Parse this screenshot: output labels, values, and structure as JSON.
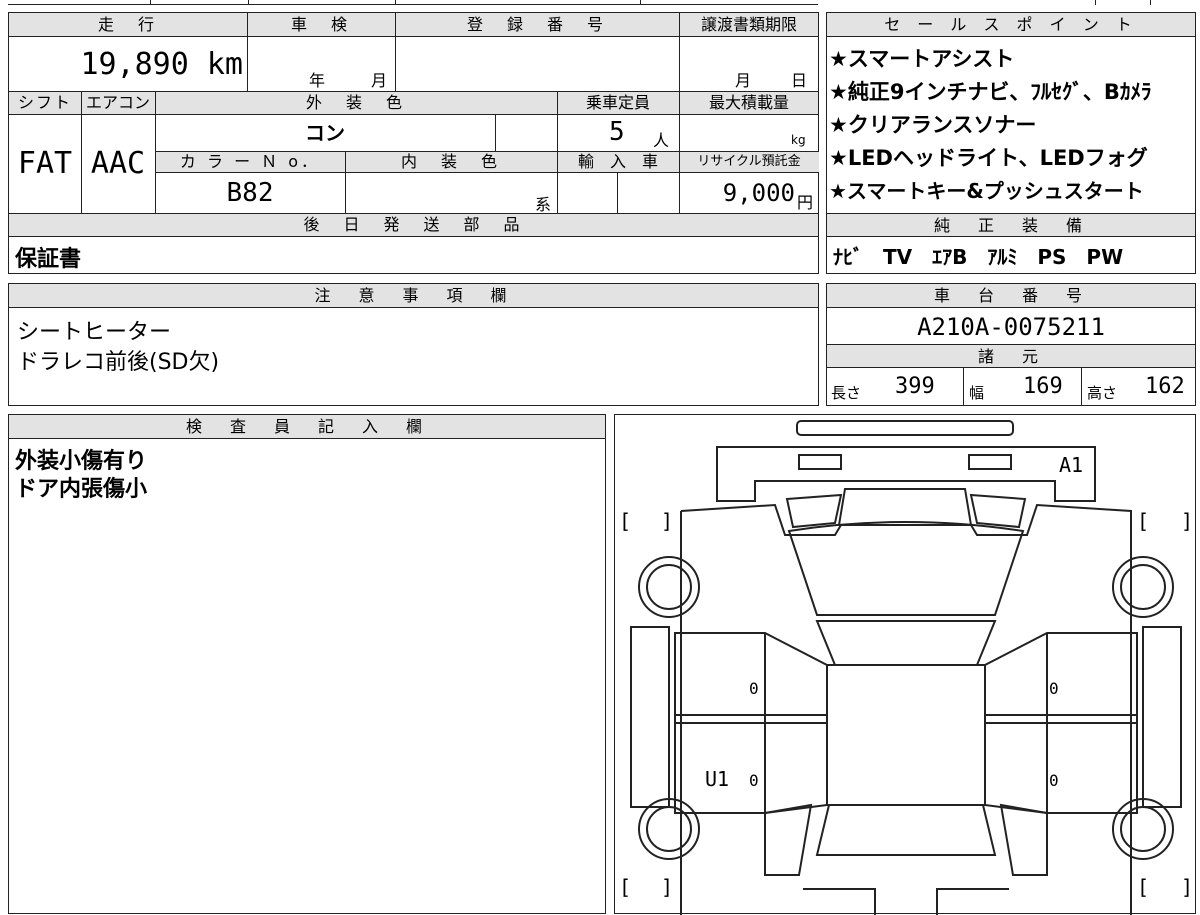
{
  "main": {
    "h_mileage": "走　行",
    "h_inspection": "車　検",
    "h_registration": "登　録　番　号",
    "h_transfer_deadline": "譲渡書類期限",
    "mileage_value": "19,890 km",
    "inspection_year": "年",
    "inspection_month": "月",
    "transfer_month": "月",
    "transfer_day": "日",
    "h_shift": "シフト",
    "h_aircon": "エアコン",
    "h_exterior_color": "外　装　色",
    "h_capacity": "乗車定員",
    "h_max_load": "最大積載量",
    "shift_value": "FAT",
    "aircon_value": "AAC",
    "exterior_color_value": "コン",
    "capacity_value": "5",
    "capacity_unit": "人",
    "max_load_unit": "kg",
    "h_color_no": "カ ラ ー Ｎ o．",
    "h_interior_color": "内　装　色",
    "h_import": "輸　入　車",
    "h_recycle": "リサイクル預託金",
    "color_no_value": "B82",
    "interior_suffix": "系",
    "recycle_value": "9,000",
    "recycle_unit": "円",
    "h_later_parts": "後　日　発　送　部　品",
    "later_parts_value": "保証書"
  },
  "sales": {
    "header": "セ ー ル ス ポ イ ン ト",
    "points": [
      "★スマートアシスト",
      "★純正9インチナビ、ﾌﾙｾｸﾞ、Bｶﾒﾗ",
      "★クリアランスソナー",
      "★LEDヘッドライト、LEDフォグ",
      "★スマートキー&プッシュスタート"
    ],
    "equipment_header": "純　正　装　備",
    "equipment_value": "ﾅﾋﾞ　TV　ｴｱB　ｱﾙﾐ　PS　PW"
  },
  "notes": {
    "header": "注　意　事　項　欄",
    "lines": [
      "シートヒーター",
      "ドラレコ前後(SD欠)"
    ]
  },
  "chassis": {
    "header": "車　台　番　号",
    "value": "A210A-0075211",
    "spec_header": "諸　元",
    "length_label": "長さ",
    "length_value": "399",
    "width_label": "幅",
    "width_value": "169",
    "height_label": "高さ",
    "height_value": "162"
  },
  "inspector": {
    "header": "検　査　員　記　入　欄",
    "lines": [
      "外装小傷有り",
      "ドア内張傷小"
    ]
  },
  "diagram": {
    "mark_a1": "A1",
    "mark_u1": "U1",
    "zero": "0",
    "bracket_l": "[",
    "bracket_r": "]"
  }
}
